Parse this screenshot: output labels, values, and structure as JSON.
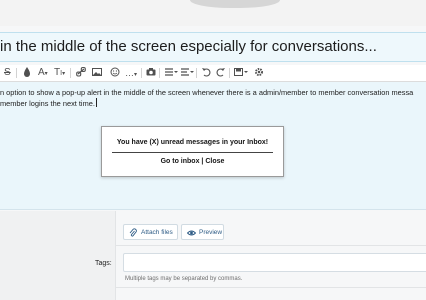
{
  "thread": {
    "title": "in the middle of the screen especially for conversations..."
  },
  "toolbar": {
    "items": [
      {
        "name": "strikethrough",
        "label": "S"
      },
      {
        "name": "color",
        "label": ""
      },
      {
        "name": "font",
        "label": "A"
      },
      {
        "name": "text-size",
        "label": "T"
      },
      {
        "name": "link",
        "label": ""
      },
      {
        "name": "image",
        "label": ""
      },
      {
        "name": "smilies",
        "label": ""
      },
      {
        "name": "more",
        "label": "…"
      },
      {
        "name": "media",
        "label": ""
      },
      {
        "name": "list",
        "label": ""
      },
      {
        "name": "align",
        "label": ""
      },
      {
        "name": "undo",
        "label": ""
      },
      {
        "name": "redo",
        "label": ""
      },
      {
        "name": "drafts",
        "label": ""
      },
      {
        "name": "settings",
        "label": ""
      }
    ]
  },
  "editor": {
    "line1": "n option to show a pop-up alert in the middle of the screen whenever there is a admin/member to member conversation messa",
    "line2": "member logins the next time."
  },
  "popup": {
    "message": "You have (X) unread messages in your Inbox!",
    "link_inbox": "Go to inbox",
    "separator": "|",
    "link_close": "Close"
  },
  "buttons": {
    "attach": "Attach files",
    "preview": "Preview"
  },
  "tags": {
    "label": "Tags:",
    "value": "",
    "hint": "Multiple tags may be separated by commas."
  },
  "colors": {
    "accent": "#2d5b85",
    "editor_bg": "#eaf6fb",
    "border": "#bfe0ee"
  }
}
